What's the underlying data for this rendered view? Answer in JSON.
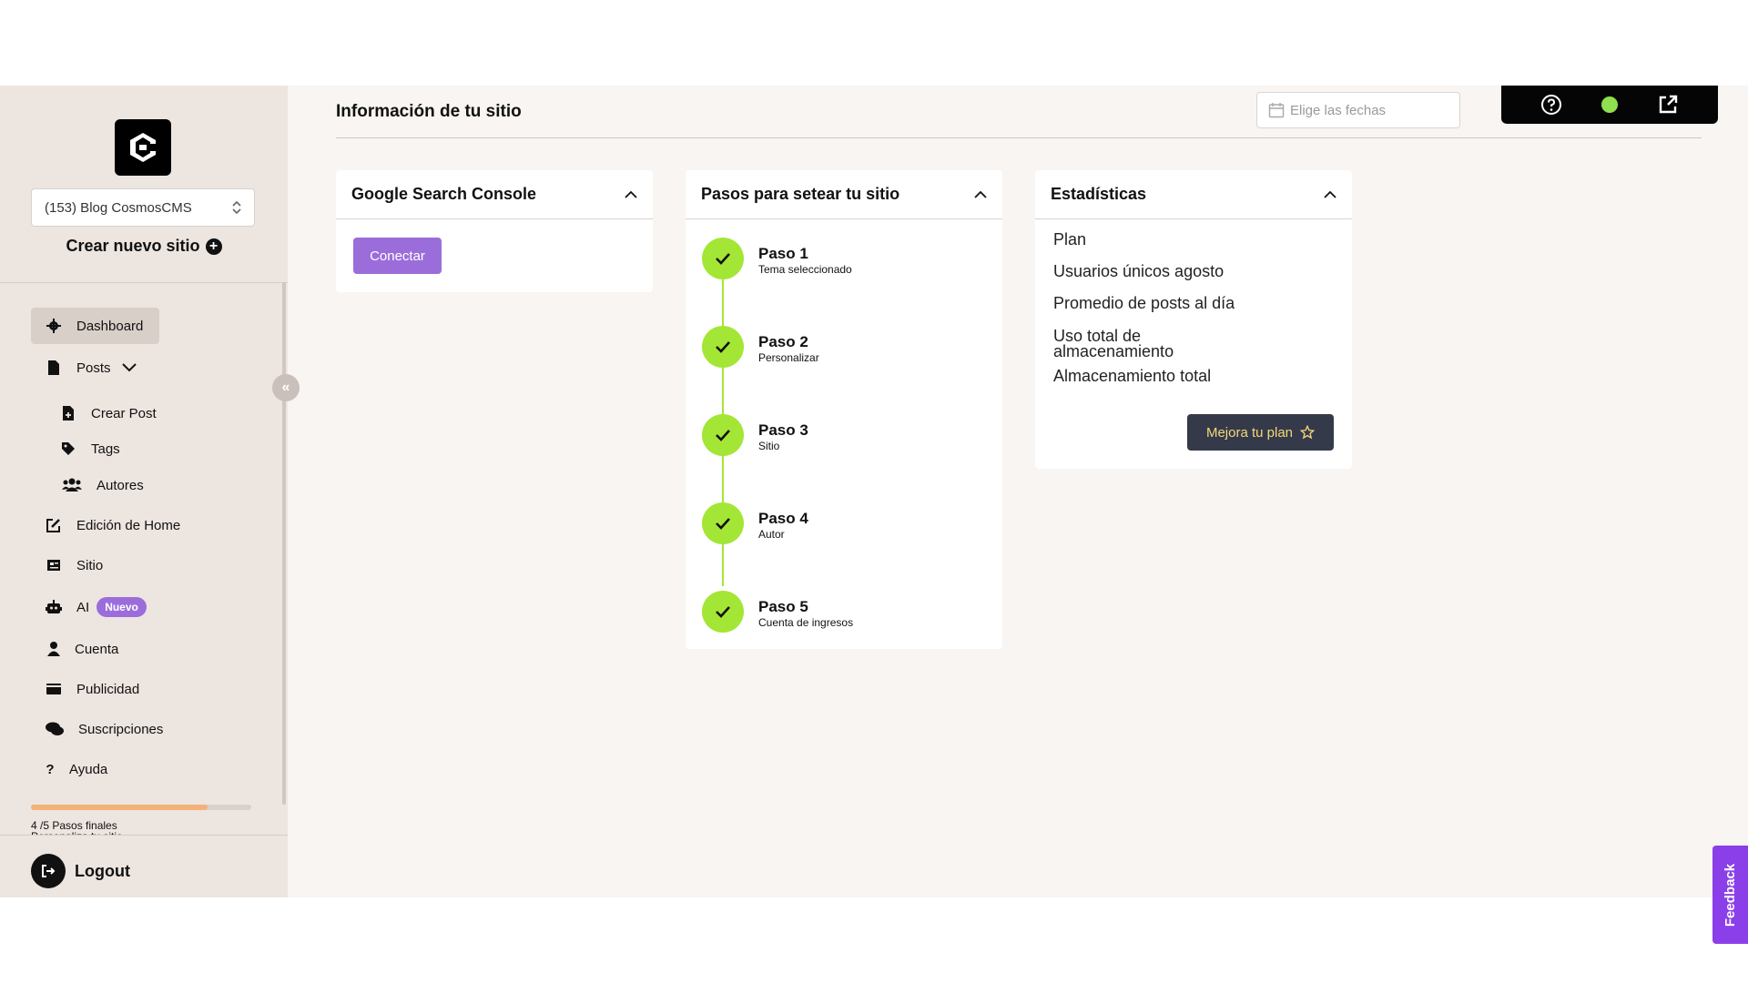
{
  "sidebar": {
    "site_select": "(153) Blog CosmosCMS",
    "new_site": "Crear nuevo sitio",
    "items": [
      {
        "label": "Dashboard",
        "icon": "gear-icon"
      },
      {
        "label": "Posts",
        "icon": "file-icon"
      },
      {
        "label": "Crear Post",
        "icon": "file-plus-icon"
      },
      {
        "label": "Tags",
        "icon": "tag-icon"
      },
      {
        "label": "Autores",
        "icon": "users-icon"
      },
      {
        "label": "Edición de Home",
        "icon": "edit-icon"
      },
      {
        "label": "Sitio",
        "icon": "newspaper-icon"
      },
      {
        "label": "AI",
        "icon": "robot-icon",
        "badge": "Nuevo"
      },
      {
        "label": "Cuenta",
        "icon": "user-icon"
      },
      {
        "label": "Publicidad",
        "icon": "billboard-icon"
      },
      {
        "label": "Suscripciones",
        "icon": "comments-icon"
      },
      {
        "label": "Ayuda",
        "icon": "question-icon"
      }
    ],
    "progress": {
      "fraction": 0.8,
      "text": "4 /5 Pasos finales",
      "text2": "Personaliza tu sitio"
    },
    "logout": "Logout"
  },
  "main": {
    "title": "Información de tu sitio",
    "date_placeholder": "Elige las fechas",
    "cards": {
      "gsc": {
        "title": "Google Search Console",
        "button": "Conectar"
      },
      "steps": {
        "title": "Pasos para setear tu sitio",
        "items": [
          {
            "title": "Paso 1",
            "sub": "Tema seleccionado"
          },
          {
            "title": "Paso 2",
            "sub": "Personalizar"
          },
          {
            "title": "Paso 3",
            "sub": "Sitio"
          },
          {
            "title": "Paso 4",
            "sub": "Autor"
          },
          {
            "title": "Paso 5",
            "sub": "Cuenta de ingresos"
          }
        ]
      },
      "stats": {
        "title": "Estadísticas",
        "items": [
          "Plan",
          "Usuarios únicos agosto",
          "Promedio de posts al día",
          "Uso total de almacenamiento",
          "Almacenamiento total"
        ],
        "button": "Mejora tu plan"
      }
    }
  },
  "feedback": "Feedback",
  "colors": {
    "accent": "#9b6ddb",
    "step": "#a3e635",
    "feedback": "#8b3fe8",
    "upgrade_bg": "#353a4a",
    "upgrade_text": "#f5d87a"
  }
}
